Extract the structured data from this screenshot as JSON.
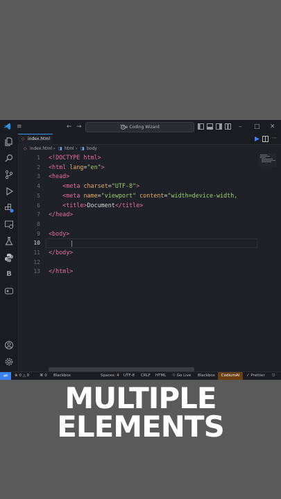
{
  "window": {
    "search_text": "The Coding Wizard"
  },
  "tab": {
    "label": "index.html"
  },
  "breadcrumb": {
    "file": "index.html",
    "html": "html",
    "body": "body"
  },
  "line_numbers": [
    "1",
    "2",
    "3",
    "4",
    "5",
    "6",
    "7",
    "8",
    "9",
    "10",
    "11",
    "12",
    "13"
  ],
  "code": {
    "l1": {
      "tag": "<!DOCTYPE html>"
    },
    "l2": {
      "open": "<html",
      "attr": "lang",
      "eq": "=",
      "val": "\"en\"",
      "close": ">"
    },
    "l3": {
      "tag": "<head>"
    },
    "l4": {
      "open": "<meta",
      "attr": "charset",
      "eq": "=",
      "val": "\"UTF-8\"",
      "close": ">"
    },
    "l5": {
      "open": "<meta",
      "attr1": "name",
      "eq1": "=",
      "val1": "\"viewport\"",
      "attr2": "content",
      "eq2": "=",
      "val2": "\"width=device-width,"
    },
    "l6": {
      "open": "<title>",
      "text": "Document",
      "close": "</title>"
    },
    "l7": {
      "tag": "</head>"
    },
    "l9": {
      "tag": "<body>"
    },
    "l11": {
      "tag": "</body>"
    },
    "l13": {
      "tag": "</html>"
    }
  },
  "status": {
    "errors": "0",
    "warnings": "0",
    "ports": "0",
    "blackbox_left": "Blackbox",
    "spaces": "Spaces: 4",
    "encoding": "UTF-8",
    "eol": "CRLF",
    "language": "HTML",
    "golive": "Go Live",
    "blackbox_right": "Blackbox",
    "codium": "CodiumAI",
    "prettier": "Prettier"
  },
  "caption": {
    "line1": "MULTIPLE",
    "line2": "ELEMENTS"
  },
  "colors": {
    "tag": "#e06c9f",
    "attr": "#e5a85a",
    "string": "#9ece6a",
    "accent": "#3b82f6",
    "codium_bg": "#6b3e14"
  }
}
